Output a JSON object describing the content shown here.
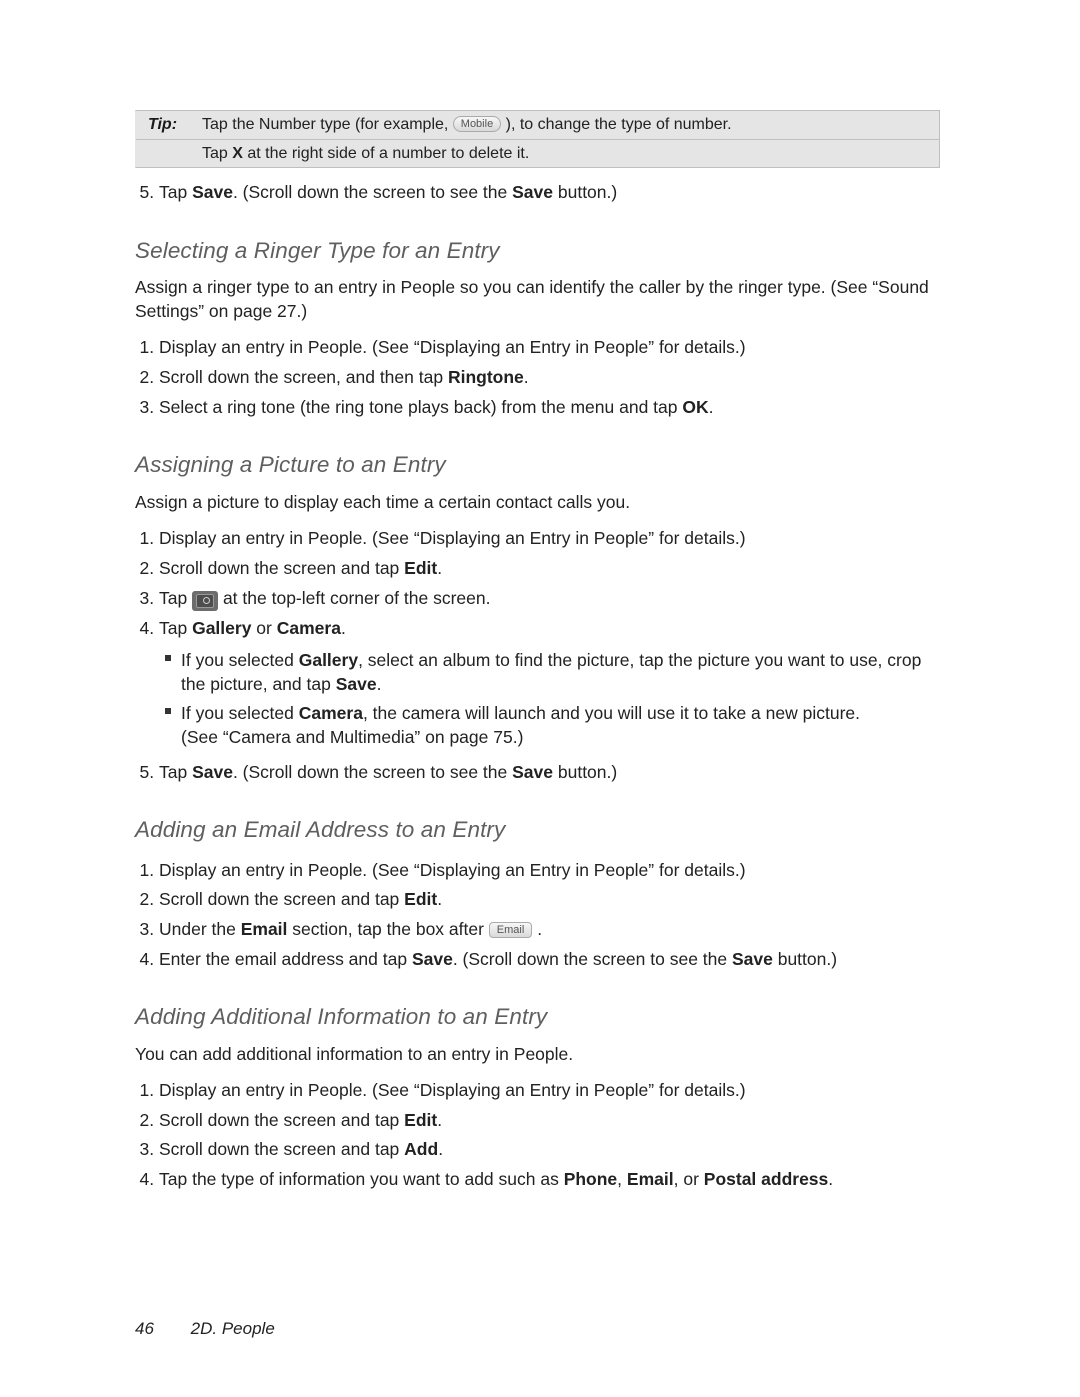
{
  "tip": {
    "label": "Tip:",
    "row1_a": "Tap the Number type (for example, ",
    "row1_chip": "Mobile",
    "row1_b": "), to change the type of number.",
    "row2_a": "Tap ",
    "row2_bold": "X",
    "row2_b": " at the right side of a number to delete it."
  },
  "step5_save": {
    "a": "Tap ",
    "b1": "Save",
    "c": ". (Scroll down the screen to see the ",
    "b2": "Save",
    "d": " button.)"
  },
  "ringer": {
    "heading": "Selecting a Ringer Type for an Entry",
    "intro": "Assign a ringer type to an entry in People so you can identify the caller by the ringer type. (See “Sound Settings” on page 27.)",
    "s1": "Display an entry in People. (See “Displaying an Entry in People” for details.)",
    "s2_a": "Scroll down the screen, and then tap ",
    "s2_b": "Ringtone",
    "s2_c": ".",
    "s3_a": "Select a ring tone (the ring tone plays back) from the menu and tap ",
    "s3_b": "OK",
    "s3_c": "."
  },
  "picture": {
    "heading": "Assigning a Picture to an Entry",
    "intro": "Assign a picture to display each time a certain contact calls you.",
    "s1": "Display an entry in People. (See “Displaying an Entry in People” for details.)",
    "s2_a": "Scroll down the screen and tap ",
    "s2_b": "Edit",
    "s2_c": ".",
    "s3_a": "Tap ",
    "s3_b": " at the top-left corner of the screen.",
    "s4_a": "Tap ",
    "s4_b1": "Gallery",
    "s4_or": " or ",
    "s4_b2": "Camera",
    "s4_c": ".",
    "sub1_a": "If you selected ",
    "sub1_b": "Gallery",
    "sub1_c": ", select an album to find the picture, tap the picture you want to use, crop the picture, and tap ",
    "sub1_d": "Save",
    "sub1_e": ".",
    "sub2_a": "If you selected ",
    "sub2_b": "Camera",
    "sub2_c": ", the camera will launch and you will use it to take a new picture.",
    "sub2_d": "(See “Camera and Multimedia” on page 75.)",
    "s5_a": "Tap ",
    "s5_b1": "Save",
    "s5_c": ". (Scroll down the screen to see the ",
    "s5_b2": "Save",
    "s5_d": " button.)"
  },
  "email": {
    "heading": "Adding an Email Address to an Entry",
    "s1": "Display an entry in People. (See “Displaying an Entry in People” for details.)",
    "s2_a": "Scroll down the screen and tap ",
    "s2_b": "Edit",
    "s2_c": ".",
    "s3_a": "Under the ",
    "s3_b": "Email",
    "s3_c": " section, tap the box after ",
    "s3_chip": "Email",
    "s3_d": ".",
    "s4_a": "Enter the email address and tap ",
    "s4_b1": "Save",
    "s4_c": ". (Scroll down the screen to see the ",
    "s4_b2": "Save",
    "s4_d": " button.)"
  },
  "additional": {
    "heading": "Adding Additional Information to an Entry",
    "intro": "You can add additional information to an entry in People.",
    "s1": "Display an entry in People. (See “Displaying an Entry in People” for details.)",
    "s2_a": "Scroll down the screen and tap ",
    "s2_b": "Edit",
    "s2_c": ".",
    "s3_a": "Scroll down the screen and tap ",
    "s3_b": "Add",
    "s3_c": ".",
    "s4_a": "Tap the type of information you want to add such as ",
    "s4_b1": "Phone",
    "s4_sep1": ", ",
    "s4_b2": "Email",
    "s4_sep2": ", or ",
    "s4_b3": "Postal address",
    "s4_c": "."
  },
  "footer": {
    "page": "46",
    "section": "2D. People"
  }
}
